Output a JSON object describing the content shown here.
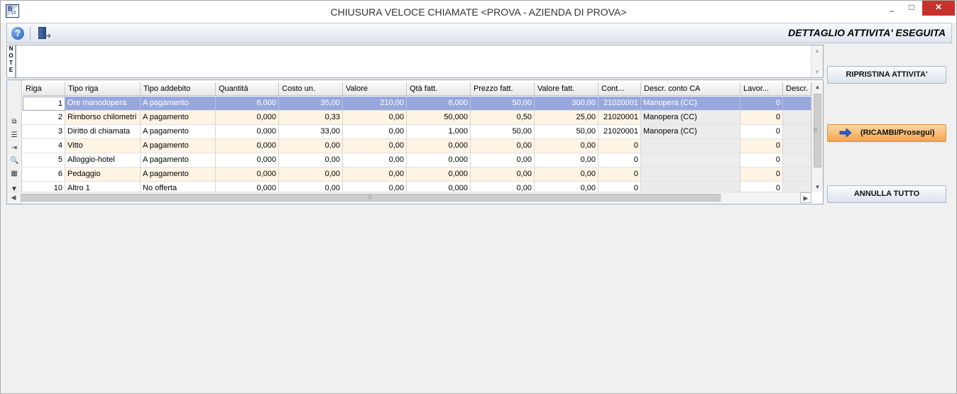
{
  "window": {
    "title": "CHIUSURA VELOCE CHIAMATE <PROVA - AZIENDA DI PROVA>",
    "app_icon_letter": "B",
    "app_icon_number": "15",
    "minimize": "_",
    "maximize": "□",
    "close": "✕"
  },
  "toolbar": {
    "help_icon": "help-icon",
    "help_glyph": "?",
    "exit_icon": "exit-door-icon",
    "heading": "DETTAGLIO ATTIVITA' ESEGUITA"
  },
  "note": {
    "label_letters": [
      "N",
      "O",
      "T",
      "E"
    ],
    "value": ""
  },
  "grid": {
    "columns": [
      "Riga",
      "Tipo riga",
      "Tipo addebito",
      "Quantità",
      "Costo un.",
      "Valore",
      "Qtà fatt.",
      "Prezzo fatt.",
      "Valore fatt.",
      "Cont...",
      "Descr. conto CA",
      "Lavor...",
      "Descr."
    ],
    "rows": [
      {
        "riga": "1",
        "tipo_riga": "Ore manodopera",
        "tipo_addebito": "A pagamento",
        "quantita": "6,000",
        "costo_un": "35,00",
        "valore": "210,00",
        "qta_fatt": "6,000",
        "prezzo_fatt": "50,00",
        "valore_fatt": "300,00",
        "conto": "21020001",
        "descr_conto": "Manopera (CC)",
        "lavor": "0",
        "descr": ""
      },
      {
        "riga": "2",
        "tipo_riga": "Rimborso chilometri",
        "tipo_addebito": "A pagamento",
        "quantita": "0,000",
        "costo_un": "0,33",
        "valore": "0,00",
        "qta_fatt": "50,000",
        "prezzo_fatt": "0,50",
        "valore_fatt": "25,00",
        "conto": "21020001",
        "descr_conto": "Manopera (CC)",
        "lavor": "0",
        "descr": ""
      },
      {
        "riga": "3",
        "tipo_riga": "Diritto di chiamata",
        "tipo_addebito": "A pagamento",
        "quantita": "0,000",
        "costo_un": "33,00",
        "valore": "0,00",
        "qta_fatt": "1,000",
        "prezzo_fatt": "50,00",
        "valore_fatt": "50,00",
        "conto": "21020001",
        "descr_conto": "Manopera (CC)",
        "lavor": "0",
        "descr": ""
      },
      {
        "riga": "4",
        "tipo_riga": "Vitto",
        "tipo_addebito": "A pagamento",
        "quantita": "0,000",
        "costo_un": "0,00",
        "valore": "0,00",
        "qta_fatt": "0,000",
        "prezzo_fatt": "0,00",
        "valore_fatt": "0,00",
        "conto": "0",
        "descr_conto": "",
        "lavor": "0",
        "descr": ""
      },
      {
        "riga": "5",
        "tipo_riga": "Alloggio-hotel",
        "tipo_addebito": "A pagamento",
        "quantita": "0,000",
        "costo_un": "0,00",
        "valore": "0,00",
        "qta_fatt": "0,000",
        "prezzo_fatt": "0,00",
        "valore_fatt": "0,00",
        "conto": "0",
        "descr_conto": "",
        "lavor": "0",
        "descr": ""
      },
      {
        "riga": "6",
        "tipo_riga": "Pedaggio",
        "tipo_addebito": "A pagamento",
        "quantita": "0,000",
        "costo_un": "0,00",
        "valore": "0,00",
        "qta_fatt": "0,000",
        "prezzo_fatt": "0,00",
        "valore_fatt": "0,00",
        "conto": "0",
        "descr_conto": "",
        "lavor": "0",
        "descr": ""
      },
      {
        "riga": "10",
        "tipo_riga": "Altro 1",
        "tipo_addebito": "No offerta",
        "quantita": "0,000",
        "costo_un": "0,00",
        "valore": "0,00",
        "qta_fatt": "0,000",
        "prezzo_fatt": "0,00",
        "valore_fatt": "0,00",
        "conto": "0",
        "descr_conto": "",
        "lavor": "0",
        "descr": ""
      }
    ],
    "selected_row": "1",
    "row_tool_icons": [
      "copy-rows-icon",
      "list-icon",
      "insert-row-icon",
      "search-icon",
      "grid-view-icon",
      "filter-icon"
    ]
  },
  "buttons": {
    "ripristina": "RIPRISTINA ATTIVITA'",
    "prosegui": "(RICAMBI/Prosegui)",
    "annulla": "ANNULLA TUTTO"
  },
  "colors": {
    "selected_row": "#98a8dc",
    "alt_row": "#fdf4e4",
    "orange_button": "#f2a64a",
    "close_button": "#c7312b"
  }
}
